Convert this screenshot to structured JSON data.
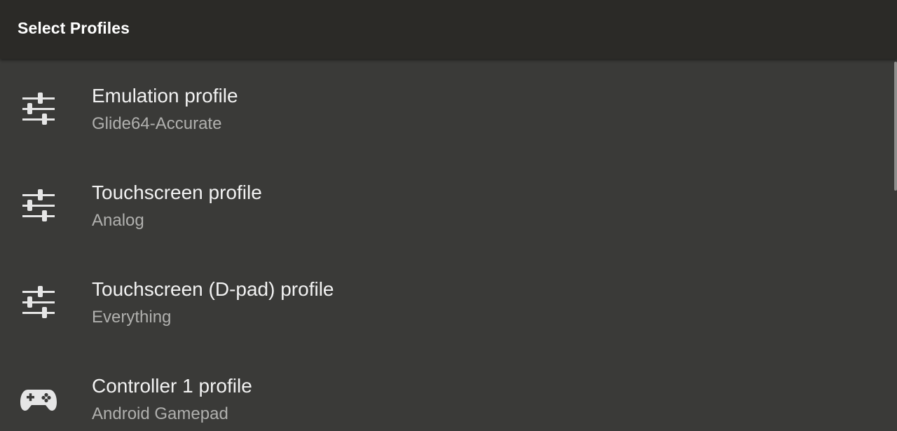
{
  "appbar": {
    "title": "Select Profiles"
  },
  "items": [
    {
      "icon": "settings-sliders-icon",
      "title": "Emulation profile",
      "summary": "Glide64-Accurate"
    },
    {
      "icon": "settings-sliders-icon",
      "title": "Touchscreen profile",
      "summary": "Analog"
    },
    {
      "icon": "settings-sliders-icon",
      "title": "Touchscreen (D-pad) profile",
      "summary": "Everything"
    },
    {
      "icon": "gamepad-icon",
      "title": "Controller 1 profile",
      "summary": "Android Gamepad"
    }
  ],
  "colors": {
    "background": "#3a3a38",
    "appbar": "#2b2a27",
    "title_text": "#f2f2f2",
    "summary_text": "#b0b0ae",
    "icon": "#e6e6e6"
  }
}
